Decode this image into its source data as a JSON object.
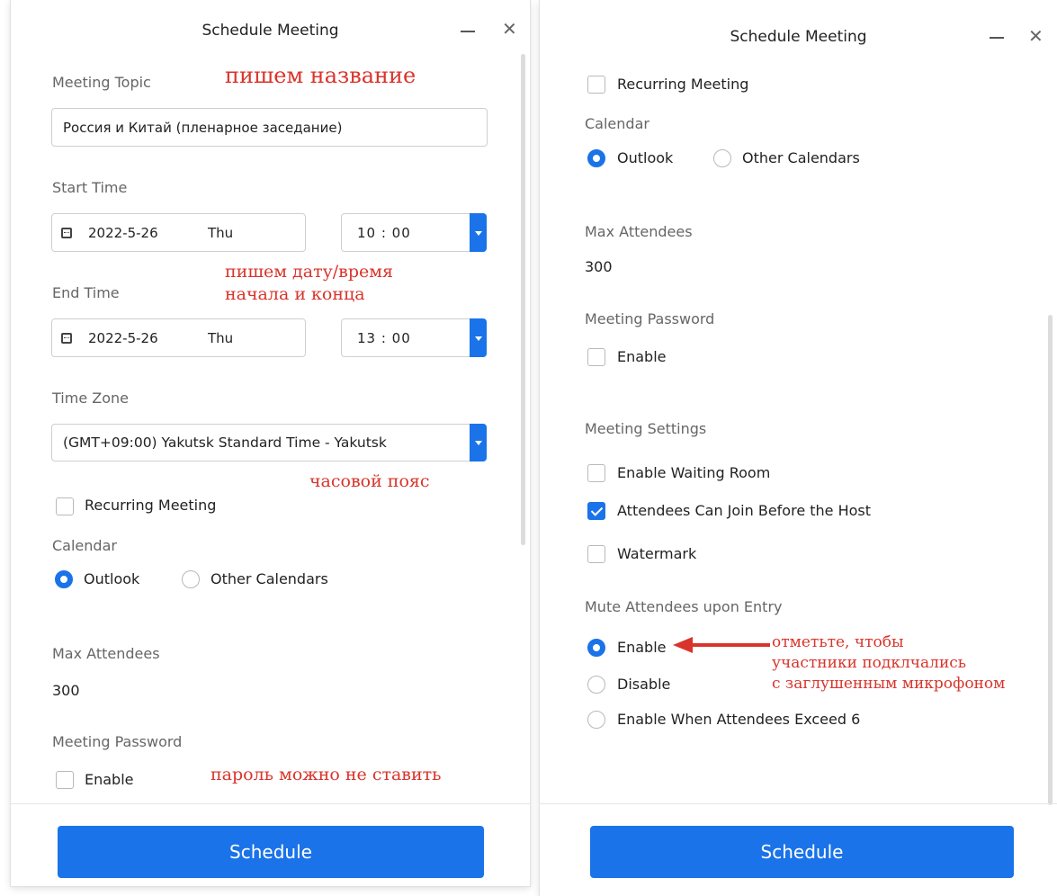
{
  "window_title": "Schedule Meeting",
  "left": {
    "meeting_topic_label": "Meeting Topic",
    "meeting_topic_value": "Россия и Китай (пленарное заседание)",
    "start_time_label": "Start Time",
    "start_date": "2022-5-26",
    "start_day": "Thu",
    "start_time": "10 : 00",
    "end_time_label": "End Time",
    "end_date": "2022-5-26",
    "end_day": "Thu",
    "end_time": "13 : 00",
    "time_zone_label": "Time Zone",
    "time_zone_value": "(GMT+09:00) Yakutsk Standard Time - Yakutsk",
    "recurring_label": "Recurring Meeting",
    "recurring_checked": false,
    "calendar_label": "Calendar",
    "calendar_option_outlook": "Outlook",
    "calendar_option_other": "Other Calendars",
    "calendar_selected": "Outlook",
    "max_attendees_label": "Max Attendees",
    "max_attendees_value": "300",
    "meeting_password_label": "Meeting Password",
    "password_enable_label": "Enable",
    "password_enabled": false,
    "schedule_button": "Schedule"
  },
  "right": {
    "recurring_label": "Recurring Meeting",
    "calendar_label": "Calendar",
    "calendar_option_outlook": "Outlook",
    "calendar_option_other": "Other Calendars",
    "max_attendees_label": "Max Attendees",
    "max_attendees_value": "300",
    "meeting_password_label": "Meeting Password",
    "password_enable_label": "Enable",
    "meeting_settings_label": "Meeting Settings",
    "waiting_room_label": "Enable Waiting Room",
    "waiting_room_checked": false,
    "join_before_host_label": "Attendees Can Join Before the Host",
    "join_before_host_checked": true,
    "watermark_label": "Watermark",
    "watermark_checked": false,
    "mute_label": "Mute Attendees upon Entry",
    "mute_enable": "Enable",
    "mute_disable": "Disable",
    "mute_exceed": "Enable When Attendees Exceed 6",
    "mute_selected": "Enable",
    "schedule_button": "Schedule"
  },
  "annotations": {
    "topic_note": "пишем название",
    "datetime_note_line1": "пишем дату/время",
    "datetime_note_line2": "начала и конца",
    "timezone_note": "часовой пояс",
    "password_note": "пароль можно не ставить",
    "mute_note_line1": "отметьте, чтобы",
    "mute_note_line2": "участники подклчались",
    "mute_note_line3": "с заглушенным микрофоном"
  },
  "colors": {
    "accent": "#1a73e8",
    "annotation": "#d9342b"
  }
}
